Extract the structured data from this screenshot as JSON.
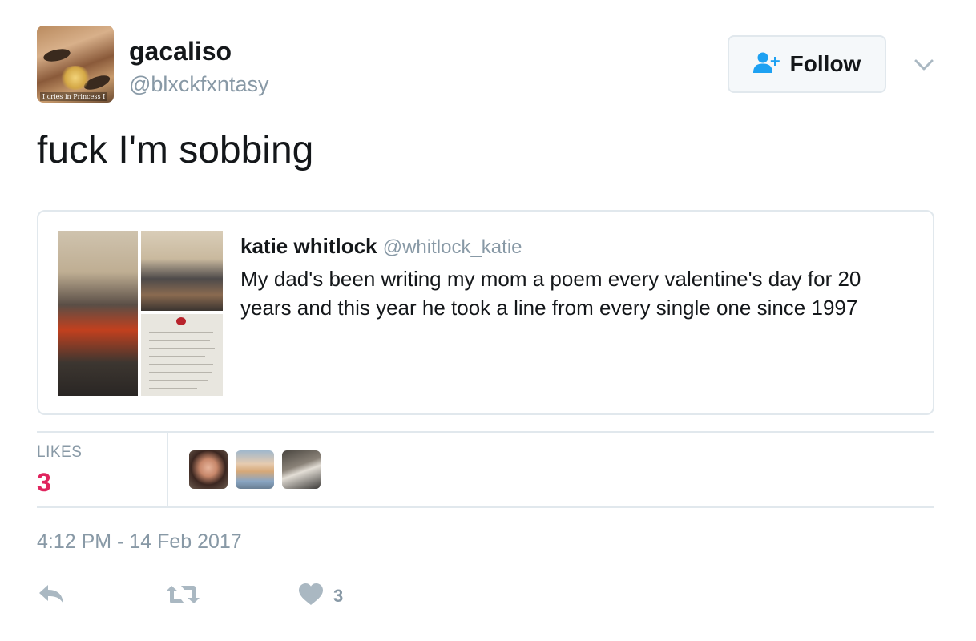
{
  "author": {
    "name": "gacaliso",
    "handle": "@blxckfxntasy",
    "avatar_caption": "I cries in Princess I"
  },
  "follow_button": {
    "label": "Follow",
    "icon": "add-user-icon"
  },
  "menu": {
    "icon": "chevron-down-icon"
  },
  "tweet": {
    "text": "fuck I'm sobbing"
  },
  "quoted_tweet": {
    "name": "katie whitlock",
    "handle": "@whitlock_katie",
    "text": "My dad's been writing my mom a poem every valentine's day for 20 years and this year he took a line from every single one since 1997"
  },
  "stats": {
    "likes_label": "LIKES",
    "likes_count": "3"
  },
  "timestamp": "4:12 PM - 14 Feb 2017",
  "actions": {
    "reply_icon": "reply-icon",
    "retweet_icon": "retweet-icon",
    "like_icon": "heart-icon",
    "like_count": "3"
  },
  "colors": {
    "text": "#14171a",
    "muted": "#8899a6",
    "border": "#e1e8ed",
    "like_accent": "#e0245e",
    "follow_icon": "#1da1f2",
    "action_icon": "#aab8c2"
  }
}
